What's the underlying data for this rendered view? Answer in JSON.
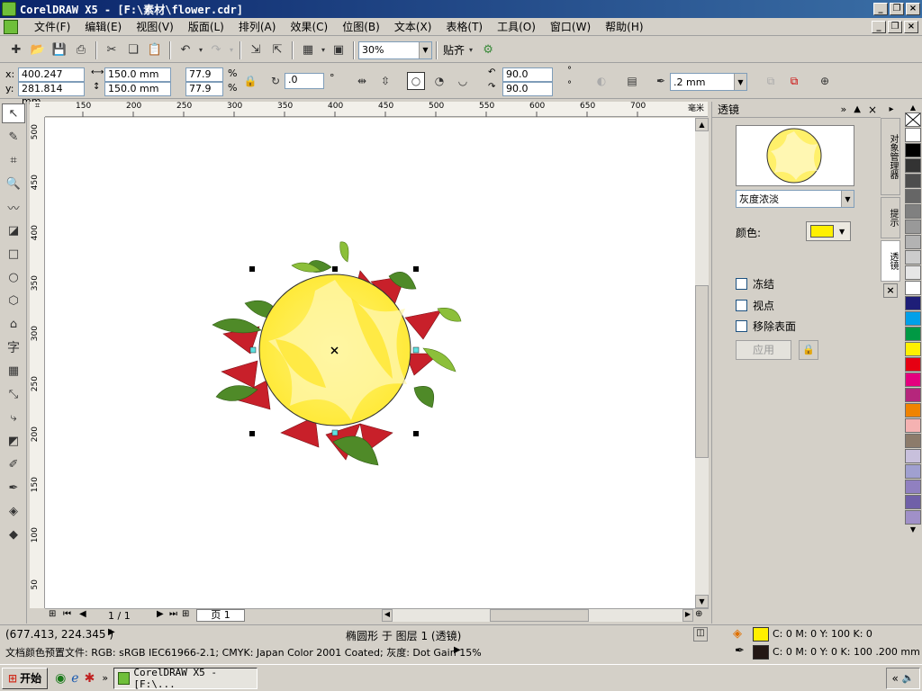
{
  "window": {
    "title": "CorelDRAW X5 - [F:\\素材\\flower.cdr]"
  },
  "menu": [
    "文件(F)",
    "编辑(E)",
    "视图(V)",
    "版面(L)",
    "排列(A)",
    "效果(C)",
    "位图(B)",
    "文本(X)",
    "表格(T)",
    "工具(O)",
    "窗口(W)",
    "帮助(H)"
  ],
  "toolbar": {
    "zoom": "30%",
    "snap_label": "贴齐"
  },
  "props": {
    "x": "400.247 mm",
    "y": "281.814 mm",
    "w": "150.0 mm",
    "h": "150.0 mm",
    "sx": "77.9",
    "sy": "77.9",
    "pct": "%",
    "angle": ".0",
    "deg": "°",
    "start_angle": "90.0",
    "end_angle": "90.0",
    "outline": ".2 mm"
  },
  "ruler_h": [
    "150",
    "200",
    "250",
    "300",
    "350",
    "400",
    "450",
    "500",
    "550",
    "600",
    "650",
    "700",
    "毫米"
  ],
  "ruler_v": [
    "500",
    "450",
    "400",
    "350",
    "300",
    "250",
    "200",
    "150",
    "100",
    "50"
  ],
  "page_nav": {
    "page_count": "1 / 1",
    "page_tab": "页 1"
  },
  "docker": {
    "title": "透镜",
    "lens_type": "灰度浓淡",
    "color_label": "颜色:",
    "lens_color": "#fff000",
    "freeze": "冻结",
    "viewpoint": "视点",
    "remove_face": "移除表面",
    "apply": "应用"
  },
  "side_tabs": [
    "对象管理器",
    "提示",
    "透镜"
  ],
  "palette_colors": [
    "#ffffff",
    "#000000",
    "#333333",
    "#4d4d4d",
    "#666666",
    "#808080",
    "#999999",
    "#b3b3b3",
    "#cccccc",
    "#e6e6e6",
    "#ffffff",
    "#1e1e78",
    "#00a0e9",
    "#009944",
    "#fff000",
    "#e60012",
    "#e4007f",
    "#b5267c",
    "#f08300",
    "#f5b2b2",
    "#8c7b6b",
    "#c8c0dc",
    "#a0a0d0",
    "#9080c0",
    "#7060a8",
    "#a090c8"
  ],
  "status": {
    "coords": "(677.413, 224.345 )",
    "object_info": "椭圆形 于 图层 1 (透镜)",
    "fill_info": "C: 0 M: 0 Y: 100 K: 0",
    "outline_info": "C: 0 M: 0 Y: 0 K: 100  .200 mm",
    "color_profile": "文档颜色预置文件: RGB: sRGB IEC61966-2.1; CMYK: Japan Color 2001 Coated; 灰度: Dot Gain 15%"
  },
  "taskbar": {
    "start": "开始",
    "task": "CorelDRAW X5 - [F:\\..."
  },
  "colors": {
    "fill": "#fff000",
    "outline": "#231815"
  }
}
